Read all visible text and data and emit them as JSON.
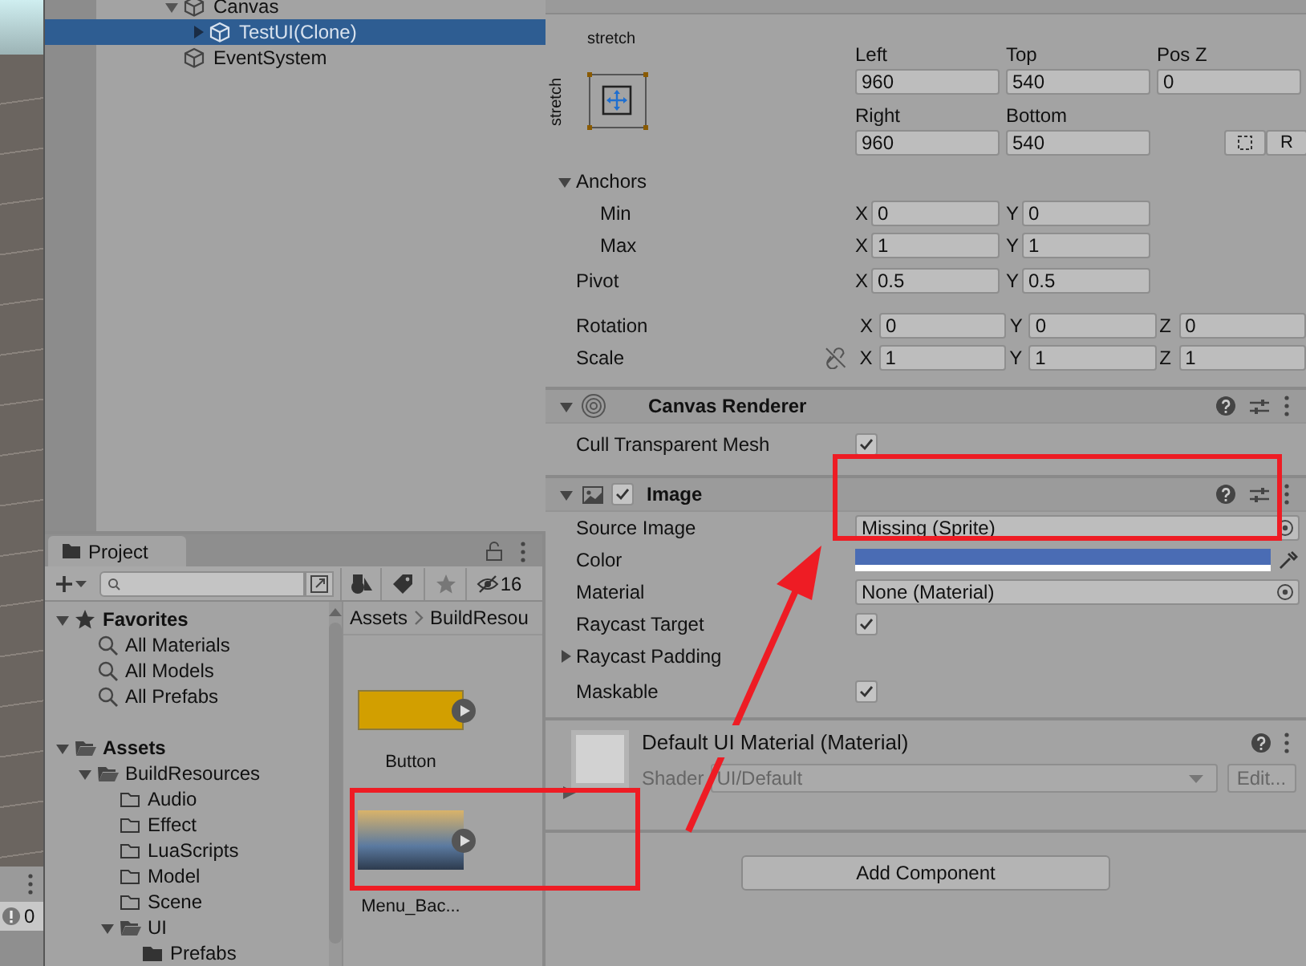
{
  "scene_view": {
    "status_count": "0"
  },
  "hierarchy": {
    "items": [
      {
        "name": "Canvas",
        "expanded": true,
        "selected": false,
        "children": [
          {
            "name": "TestUI(Clone)",
            "expanded": false,
            "selected": true
          }
        ]
      },
      {
        "name": "EventSystem",
        "selected": false
      }
    ]
  },
  "project": {
    "tab": "Project",
    "hidden_count": "16",
    "breadcrumb": [
      "Assets",
      "BuildResou"
    ],
    "tree": [
      {
        "name": "Favorites",
        "kind": "favorites",
        "expanded": true,
        "children": [
          {
            "name": "All Materials",
            "kind": "search"
          },
          {
            "name": "All Models",
            "kind": "search"
          },
          {
            "name": "All Prefabs",
            "kind": "search"
          }
        ]
      },
      {
        "name": "Assets",
        "kind": "folder",
        "expanded": true,
        "children": [
          {
            "name": "BuildResources",
            "kind": "folder",
            "expanded": true,
            "children": [
              {
                "name": "Audio",
                "kind": "folder"
              },
              {
                "name": "Effect",
                "kind": "folder"
              },
              {
                "name": "LuaScripts",
                "kind": "folder"
              },
              {
                "name": "Model",
                "kind": "folder"
              },
              {
                "name": "Scene",
                "kind": "folder"
              },
              {
                "name": "UI",
                "kind": "folder",
                "expanded": true,
                "children": [
                  {
                    "name": "Prefabs",
                    "kind": "filled_folder"
                  }
                ]
              }
            ]
          }
        ]
      }
    ],
    "assets": [
      {
        "name": "Button",
        "kind": "swatch"
      },
      {
        "name": "Menu_Bac...",
        "kind": "photo"
      }
    ]
  },
  "inspector": {
    "rect_transform": {
      "preset_top": "stretch",
      "preset_side": "stretch",
      "edges": [
        [
          {
            "label": "Left",
            "value": "960"
          },
          {
            "label": "Top",
            "value": "540"
          },
          {
            "label": "Pos Z",
            "value": "0"
          }
        ],
        [
          {
            "label": "Right",
            "value": "960"
          },
          {
            "label": "Bottom",
            "value": "540"
          }
        ]
      ],
      "raw_button": "R",
      "anchors": {
        "label": "Anchors",
        "expanded": true,
        "rows": [
          {
            "label": "Min",
            "values": [
              {
                "axis": "X",
                "value": "0"
              },
              {
                "axis": "Y",
                "value": "0"
              }
            ]
          },
          {
            "label": "Max",
            "values": [
              {
                "axis": "X",
                "value": "1"
              },
              {
                "axis": "Y",
                "value": "1"
              }
            ]
          }
        ]
      },
      "pivot": {
        "label": "Pivot",
        "values": [
          {
            "axis": "X",
            "value": "0.5"
          },
          {
            "axis": "Y",
            "value": "0.5"
          }
        ]
      },
      "rotation": {
        "label": "Rotation",
        "values": [
          {
            "axis": "X",
            "value": "0"
          },
          {
            "axis": "Y",
            "value": "0"
          },
          {
            "axis": "Z",
            "value": "0"
          }
        ]
      },
      "scale": {
        "label": "Scale",
        "values": [
          {
            "axis": "X",
            "value": "1"
          },
          {
            "axis": "Y",
            "value": "1"
          },
          {
            "axis": "Z",
            "value": "1"
          }
        ]
      }
    },
    "components": [
      {
        "title": "Canvas Renderer",
        "kind": "renderer",
        "expanded": true,
        "properties": [
          {
            "kind": "checkbox",
            "label": "Cull Transparent Mesh",
            "checked": true
          }
        ]
      },
      {
        "title": "Image",
        "kind": "image",
        "expanded": true,
        "enabled": true,
        "properties": [
          {
            "kind": "object",
            "label": "Source Image",
            "value": "Missing (Sprite)"
          },
          {
            "kind": "color",
            "label": "Color",
            "color": "#4a6cb4"
          },
          {
            "kind": "object",
            "label": "Material",
            "value": "None (Material)"
          },
          {
            "kind": "checkbox",
            "label": "Raycast Target",
            "checked": true
          },
          {
            "kind": "foldout",
            "label": "Raycast Padding",
            "expanded": false
          },
          {
            "kind": "checkbox",
            "label": "Maskable",
            "checked": true
          }
        ]
      }
    ],
    "material": {
      "title": "Default UI Material (Material)",
      "shader_label": "Shader",
      "shader": "UI/Default",
      "edit_button": "Edit..."
    },
    "add_component": "Add Component"
  }
}
